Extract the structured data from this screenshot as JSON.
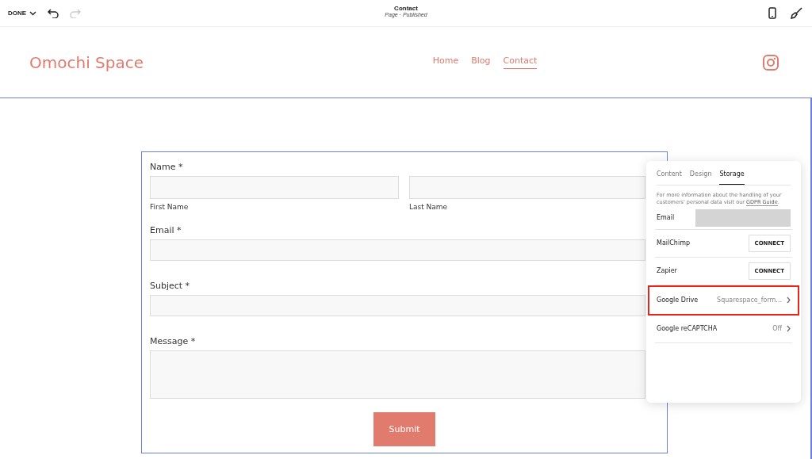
{
  "toolbar": {
    "done_label": "DONE",
    "page_title": "Contact",
    "page_status": "Page · Published"
  },
  "site": {
    "logo": "Omochi Space",
    "nav": [
      {
        "label": "Home",
        "selected": false
      },
      {
        "label": "Blog",
        "selected": false
      },
      {
        "label": "Contact",
        "selected": true
      }
    ]
  },
  "form": {
    "name_label": "Name *",
    "first_name_caption": "First Name",
    "last_name_caption": "Last Name",
    "fields": [
      {
        "label": "Email *",
        "kind": "line"
      },
      {
        "label": "Subject *",
        "kind": "line"
      },
      {
        "label": "Message *",
        "kind": "area"
      }
    ],
    "submit": "Submit"
  },
  "panel": {
    "tabs": [
      {
        "label": "Content",
        "selected": false
      },
      {
        "label": "Design",
        "selected": false
      },
      {
        "label": "Storage",
        "selected": true
      }
    ],
    "info": "For more information about the handling of your customers' personal data visit our ",
    "info_link": "GDPR Guide",
    "info_end": ".",
    "rows": [
      {
        "kind": "field",
        "label": "Email",
        "highlighted": false
      },
      {
        "kind": "connect",
        "label": "MailChimp",
        "action": "CONNECT",
        "highlighted": false
      },
      {
        "kind": "connect",
        "label": "Zapier",
        "action": "CONNECT",
        "highlighted": false
      },
      {
        "kind": "link",
        "label": "Google Drive",
        "value": "Squarespace_form...",
        "highlighted": true
      },
      {
        "kind": "link",
        "label": "Google reCAPTCHA",
        "value": "Off",
        "highlighted": false
      }
    ]
  }
}
